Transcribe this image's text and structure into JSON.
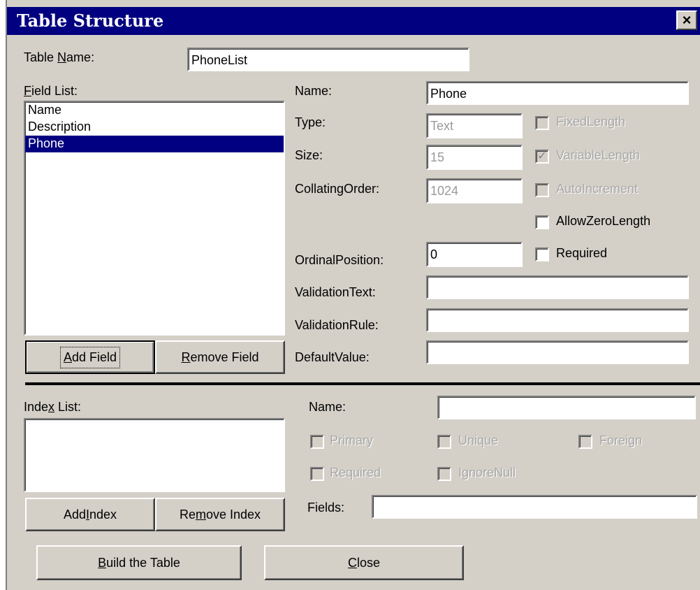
{
  "dialog": {
    "title": "Table Structure",
    "close_label": "×"
  },
  "table": {
    "name_label_pre": "Table ",
    "name_label_key": "N",
    "name_label_post": "ame:",
    "name_value": "PhoneList"
  },
  "fields": {
    "list_label_key": "F",
    "list_label_post": "ield List:",
    "items": [
      "Name",
      "Description",
      "Phone"
    ],
    "selected": "Phone",
    "add_key": "A",
    "add_post": "dd Field",
    "remove_key": "R",
    "remove_post": "emove Field"
  },
  "field_props": {
    "name_label": "Name:",
    "name_value": "Phone",
    "type_label": "Type:",
    "type_value": "Text",
    "size_label": "Size:",
    "size_value": "15",
    "collating_label": "CollatingOrder:",
    "collating_value": "1024",
    "ordinal_label": "OrdinalPosition:",
    "ordinal_value": "0",
    "validation_text_label": "ValidationText:",
    "validation_text_value": "",
    "validation_rule_label": "ValidationRule:",
    "validation_rule_value": "",
    "default_label": "DefaultValue:",
    "default_value": "",
    "fixed_length": "FixedLength",
    "variable_length": "VariableLength",
    "auto_increment": "AutoIncrement",
    "allow_zero_length": "AllowZeroLength",
    "required": "Required"
  },
  "index": {
    "list_label_pre": "Inde",
    "list_label_key": "x",
    "list_label_post": " List:",
    "name_label": "Name:",
    "name_value": "",
    "primary": "Primary",
    "unique": "Unique",
    "foreign": "Foreign",
    "required": "Required",
    "ignore_null": "IgnoreNull",
    "fields_label": "Fields:",
    "fields_value": "",
    "add_pre": "Add ",
    "add_key": "I",
    "add_post": "ndex",
    "remove_pre": "Re",
    "remove_key": "m",
    "remove_post": "ove Index"
  },
  "bottom": {
    "build_key": "B",
    "build_post": "uild the Table",
    "close_key": "C",
    "close_post": "lose"
  }
}
